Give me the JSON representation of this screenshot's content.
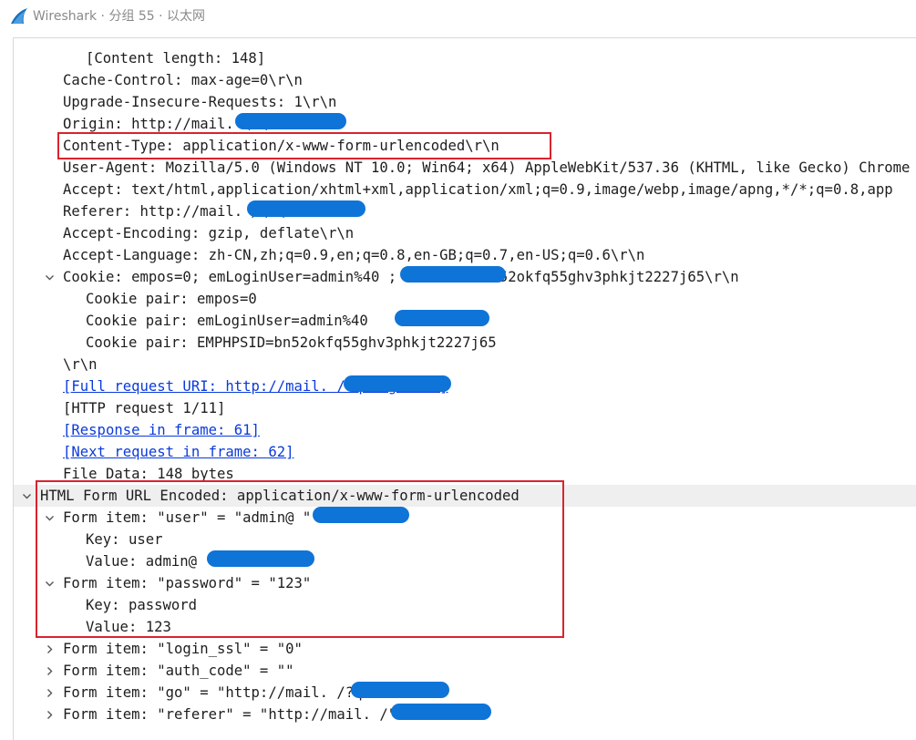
{
  "window": {
    "app_name": "Wireshark",
    "title": "Wireshark · 分组 55 · 以太网",
    "icon": "wireshark-fin-icon"
  },
  "colors": {
    "link": "#0a3bdc",
    "highlight_box": "#d9232e",
    "redaction": "#0e74d8",
    "selected_row": "#efefef"
  },
  "tree": {
    "rows": [
      {
        "text": "[Content length: 148]",
        "level": 2
      },
      {
        "text": "Cache-Control: max-age=0\\r\\n",
        "level": 1
      },
      {
        "text": "Upgrade-Insecure-Requests: 1\\r\\n",
        "level": 1
      },
      {
        "text": "Origin: http://mail.            \\r\\n",
        "level": 1
      },
      {
        "text": "Content-Type: application/x-www-form-urlencoded\\r\\n",
        "level": 1
      },
      {
        "text": "User-Agent: Mozilla/5.0 (Windows NT 10.0; Win64; x64) AppleWebKit/537.36 (KHTML, like Gecko) Chrome",
        "level": 1
      },
      {
        "text": "Accept: text/html,application/xhtml+xml,application/xml;q=0.9,image/webp,image/apng,*/*;q=0.8,app",
        "level": 1
      },
      {
        "text": "Referer: http://mail.            /\\r\\n",
        "level": 1
      },
      {
        "text": "Accept-Encoding: gzip, deflate\\r\\n",
        "level": 1
      },
      {
        "text": "Accept-Language: zh-CN,zh;q=0.9,en;q=0.8,en-GB;q=0.7,en-US;q=0.6\\r\\n",
        "level": 1
      },
      {
        "text": "Cookie: empos=0; emLoginUser=admin%40           ; EMPHPSID=bn52okfq55ghv3phkjt2227j65\\r\\n",
        "level": 1,
        "expanded": true
      },
      {
        "text": "Cookie pair: empos=0",
        "level": 2
      },
      {
        "text": "Cookie pair: emLoginUser=admin%40",
        "level": 2
      },
      {
        "text": "Cookie pair: EMPHPSID=bn52okfq55ghv3phkjt2227j65",
        "level": 2
      },
      {
        "text": "\\r\\n",
        "level": 1
      },
      {
        "text": "[Full request URI: http://mail.            /?q=login.do]",
        "level": 1,
        "link": true
      },
      {
        "text": "[HTTP request 1/11]",
        "level": 1
      },
      {
        "text": "[Response in frame: 61]",
        "level": 1,
        "link": true
      },
      {
        "text": "[Next request in frame: 62]",
        "level": 1,
        "link": true
      },
      {
        "text": "File Data: 148 bytes",
        "level": 1
      },
      {
        "text": "HTML Form URL Encoded: application/x-www-form-urlencoded",
        "level": 0,
        "expanded": true,
        "selected": true
      },
      {
        "text": "Form item: \"user\" = \"admin@           \"",
        "level": 1,
        "expanded": true
      },
      {
        "text": "Key: user",
        "level": 2
      },
      {
        "text": "Value: admin@",
        "level": 2
      },
      {
        "text": "Form item: \"password\" = \"123\"",
        "level": 1,
        "expanded": true
      },
      {
        "text": "Key: password",
        "level": 2
      },
      {
        "text": "Value: 123",
        "level": 2
      },
      {
        "text": "Form item: \"login_ssl\" = \"0\"",
        "level": 1,
        "expanded": false
      },
      {
        "text": "Form item: \"auth_code\" = \"\"",
        "level": 1,
        "expanded": false
      },
      {
        "text": "Form item: \"go\" = \"http://mail.            /?q=base\"",
        "level": 1,
        "expanded": false
      },
      {
        "text": "Form item: \"referer\" = \"http://mail.            /\"",
        "level": 1,
        "expanded": false
      }
    ]
  }
}
